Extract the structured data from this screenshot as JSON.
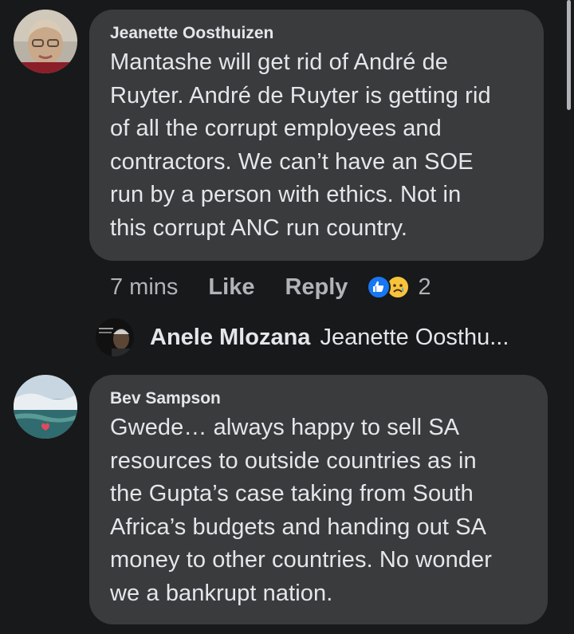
{
  "comments": [
    {
      "author": "Jeanette Oosthuizen",
      "lines": [
        "Mantashe will get rid of André de",
        "Ruyter. André de Ruyter is getting rid",
        "of all the corrupt employees and",
        "contractors. We can’t have an SOE",
        "run by a person with ethics. Not in",
        "this corrupt ANC run country."
      ],
      "time": "7 mins",
      "like_label": "Like",
      "reply_label": "Reply",
      "reaction_count": "2",
      "reactions": [
        "like-icon",
        "sad-icon"
      ],
      "avatar_icon": "profile-photo-jeanette"
    },
    {
      "author": "Bev Sampson",
      "lines": [
        "Gwede… always happy to sell SA",
        "resources to outside countries as in",
        "the Gupta’s case taking from South",
        "Africa’s budgets and handing out SA",
        "money to other countries. No wonder",
        "we a bankrupt nation."
      ],
      "avatar_icon": "profile-photo-bev"
    }
  ],
  "reply_preview": {
    "author": "Anele Mlozana",
    "snippet": "Jeanette Oosthu...",
    "avatar_icon": "profile-photo-anele"
  },
  "colors": {
    "background": "#18191a",
    "bubble": "#3a3b3c",
    "text": "#e4e6eb",
    "muted": "#b0b3b8",
    "like_blue": "#1877f2",
    "sad_yellow": "#f7c33b"
  }
}
